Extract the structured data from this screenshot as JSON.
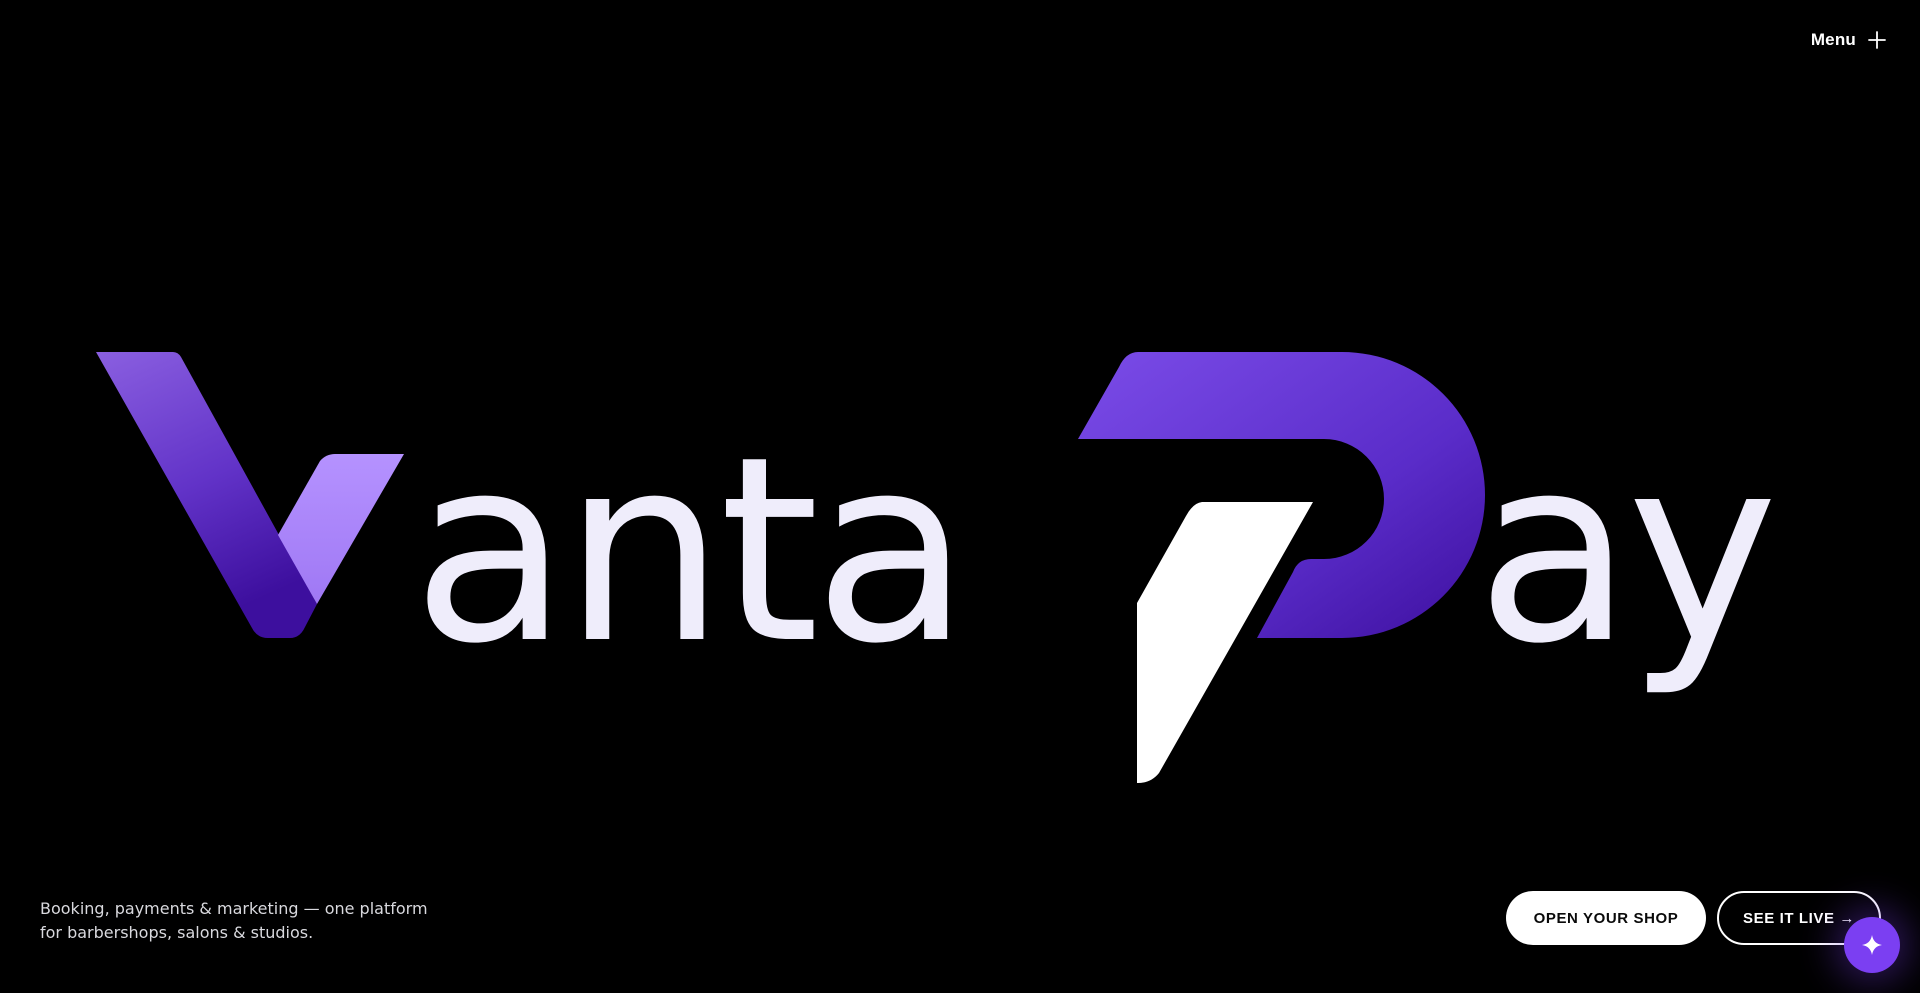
{
  "header": {
    "menu_label": "Menu",
    "menu_icon": "plus-icon"
  },
  "hero": {
    "brand_name": "VantaPay",
    "brand_segments": {
      "first_initial": "V",
      "first_rest": "anta",
      "second_initial": "P",
      "second_rest": "ay"
    },
    "colors": {
      "background": "#000000",
      "letter_fill": "#efedfb",
      "accent_light": "#b592ff",
      "accent_mid": "#7b4ce8",
      "accent_dark": "#3d0f9e",
      "p_stem": "#ffffff"
    }
  },
  "footer": {
    "tagline_line1": "Booking, payments & marketing — one platform",
    "tagline_line2": "for barbershops, salons & studios.",
    "primary_cta": "OPEN YOUR SHOP",
    "secondary_cta": "SEE IT LIVE →"
  },
  "assistant": {
    "icon": "sparkle-icon",
    "color": "#7b3ff2"
  }
}
